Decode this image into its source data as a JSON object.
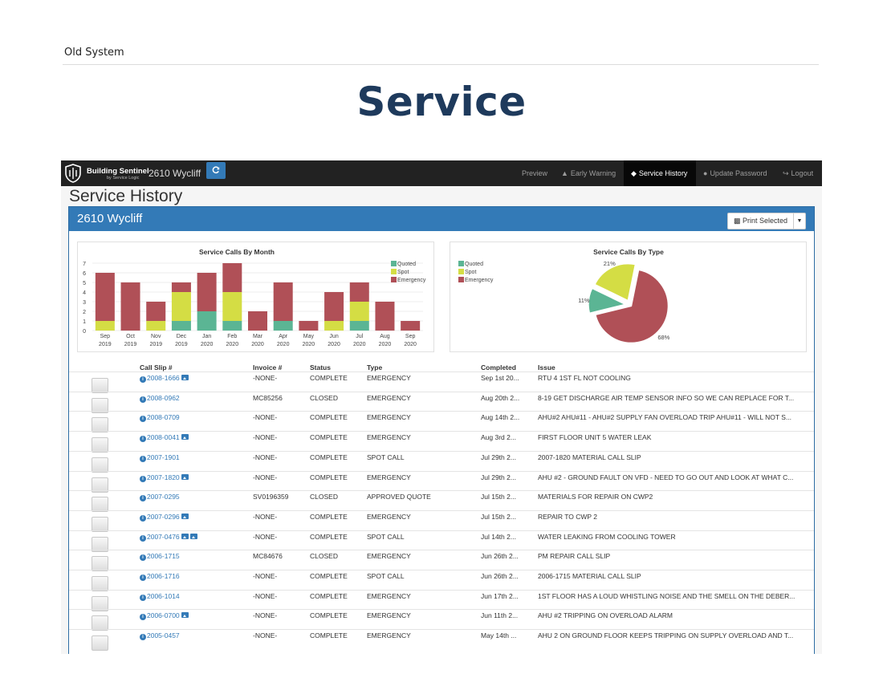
{
  "header": {
    "old_system": "Old System",
    "title": "Service"
  },
  "navbar": {
    "brand_name": "Building Sentinel",
    "brand_sub": "by Service Logic",
    "building": "2610 Wycliff",
    "items": [
      {
        "label": "Preview",
        "icon": ""
      },
      {
        "label": "Early Warning",
        "icon": "megaphone-icon"
      },
      {
        "label": "Service History",
        "icon": "tag-icon",
        "active": true
      },
      {
        "label": "Update Password",
        "icon": "user-icon"
      },
      {
        "label": "Logout",
        "icon": "logout-icon"
      }
    ]
  },
  "page": {
    "title": "Service History"
  },
  "panel": {
    "title": "2610 Wycliff",
    "print_label": "Print Selected"
  },
  "colors": {
    "quoted": "#5bb594",
    "spot": "#d4dd44",
    "emergency": "#b05057",
    "primary": "#337ab7",
    "nav": "#222222"
  },
  "chart_data": [
    {
      "type": "bar",
      "title": "Service Calls By Month",
      "categories": [
        [
          "Sep",
          "2019"
        ],
        [
          "Oct",
          "2019"
        ],
        [
          "Nov",
          "2019"
        ],
        [
          "Dec",
          "2019"
        ],
        [
          "Jan",
          "2020"
        ],
        [
          "Feb",
          "2020"
        ],
        [
          "Mar",
          "2020"
        ],
        [
          "Apr",
          "2020"
        ],
        [
          "May",
          "2020"
        ],
        [
          "Jun",
          "2020"
        ],
        [
          "Jul",
          "2020"
        ],
        [
          "Aug",
          "2020"
        ],
        [
          "Sep",
          "2020"
        ]
      ],
      "series": [
        {
          "name": "Quoted",
          "values": [
            0,
            0,
            0,
            1,
            2,
            1,
            0,
            1,
            0,
            0,
            1,
            0,
            0
          ]
        },
        {
          "name": "Spot",
          "values": [
            1,
            0,
            1,
            3,
            0,
            3,
            0,
            0,
            0,
            1,
            2,
            0,
            0
          ]
        },
        {
          "name": "Emergency",
          "values": [
            5,
            5,
            2,
            1,
            4,
            3,
            2,
            4,
            1,
            3,
            2,
            3,
            1
          ]
        }
      ],
      "ylim": [
        0,
        7
      ],
      "yticks": [
        "0",
        "1",
        "2",
        "3",
        "4",
        "5",
        "6",
        "7"
      ],
      "legend": "top-right",
      "grid": true
    },
    {
      "type": "pie",
      "title": "Service Calls By Type",
      "labels": [
        "Quoted",
        "Spot",
        "Emergency"
      ],
      "values": [
        11,
        21,
        68
      ],
      "value_labels": [
        "11%",
        "21%",
        "68%"
      ],
      "legend": "top-left"
    }
  ],
  "table": {
    "headers": [
      "Call Slip #",
      "Invoice #",
      "Status",
      "Type",
      "Completed",
      "Issue"
    ],
    "rows": [
      {
        "slip": "2008-1666",
        "pics": 1,
        "invoice": "-NONE-",
        "status": "COMPLETE",
        "type": "EMERGENCY",
        "completed": "Sep 1st 20...",
        "issue": "RTU 4 1ST FL NOT COOLING"
      },
      {
        "slip": "2008-0962",
        "pics": 0,
        "invoice": "MC85256",
        "status": "CLOSED",
        "type": "EMERGENCY",
        "completed": "Aug 20th 2...",
        "issue": "8-19 GET DISCHARGE AIR TEMP SENSOR INFO SO WE CAN REPLACE FOR T..."
      },
      {
        "slip": "2008-0709",
        "pics": 0,
        "invoice": "-NONE-",
        "status": "COMPLETE",
        "type": "EMERGENCY",
        "completed": "Aug 14th 2...",
        "issue": "AHU#2 AHU#11 - AHU#2 SUPPLY FAN OVERLOAD TRIP AHU#11 - WILL NOT S..."
      },
      {
        "slip": "2008-0041",
        "pics": 1,
        "invoice": "-NONE-",
        "status": "COMPLETE",
        "type": "EMERGENCY",
        "completed": "Aug 3rd 2...",
        "issue": "FIRST FLOOR UNIT 5 WATER LEAK"
      },
      {
        "slip": "2007-1901",
        "pics": 0,
        "invoice": "-NONE-",
        "status": "COMPLETE",
        "type": "SPOT CALL",
        "completed": "Jul 29th 2...",
        "issue": "2007-1820 MATERIAL CALL SLIP"
      },
      {
        "slip": "2007-1820",
        "pics": 1,
        "invoice": "-NONE-",
        "status": "COMPLETE",
        "type": "EMERGENCY",
        "completed": "Jul 29th 2...",
        "issue": "AHU #2 - GROUND FAULT ON VFD - NEED TO GO OUT AND LOOK AT WHAT C..."
      },
      {
        "slip": "2007-0295",
        "pics": 0,
        "invoice": "SV0196359",
        "status": "CLOSED",
        "type": "APPROVED QUOTE",
        "completed": "Jul 15th 2...",
        "issue": "MATERIALS FOR REPAIR ON CWP2"
      },
      {
        "slip": "2007-0296",
        "pics": 1,
        "invoice": "-NONE-",
        "status": "COMPLETE",
        "type": "EMERGENCY",
        "completed": "Jul 15th 2...",
        "issue": "REPAIR TO CWP 2"
      },
      {
        "slip": "2007-0476",
        "pics": 2,
        "invoice": "-NONE-",
        "status": "COMPLETE",
        "type": "SPOT CALL",
        "completed": "Jul 14th 2...",
        "issue": "WATER LEAKING FROM COOLING TOWER"
      },
      {
        "slip": "2006-1715",
        "pics": 0,
        "invoice": "MC84676",
        "status": "CLOSED",
        "type": "EMERGENCY",
        "completed": "Jun 26th 2...",
        "issue": "PM REPAIR CALL SLIP"
      },
      {
        "slip": "2006-1716",
        "pics": 0,
        "invoice": "-NONE-",
        "status": "COMPLETE",
        "type": "SPOT CALL",
        "completed": "Jun 26th 2...",
        "issue": "2006-1715 MATERIAL CALL SLIP"
      },
      {
        "slip": "2006-1014",
        "pics": 0,
        "invoice": "-NONE-",
        "status": "COMPLETE",
        "type": "EMERGENCY",
        "completed": "Jun 17th 2...",
        "issue": "1ST FLOOR HAS A LOUD WHISTLING NOISE AND THE SMELL ON THE DEBER..."
      },
      {
        "slip": "2006-0700",
        "pics": 1,
        "invoice": "-NONE-",
        "status": "COMPLETE",
        "type": "EMERGENCY",
        "completed": "Jun 11th 2...",
        "issue": "AHU #2 TRIPPING ON OVERLOAD ALARM"
      },
      {
        "slip": "2005-0457",
        "pics": 0,
        "invoice": "-NONE-",
        "status": "COMPLETE",
        "type": "EMERGENCY",
        "completed": "May 14th ...",
        "issue": "AHU 2 ON GROUND FLOOR KEEPS TRIPPING ON SUPPLY OVERLOAD AND T..."
      }
    ]
  }
}
